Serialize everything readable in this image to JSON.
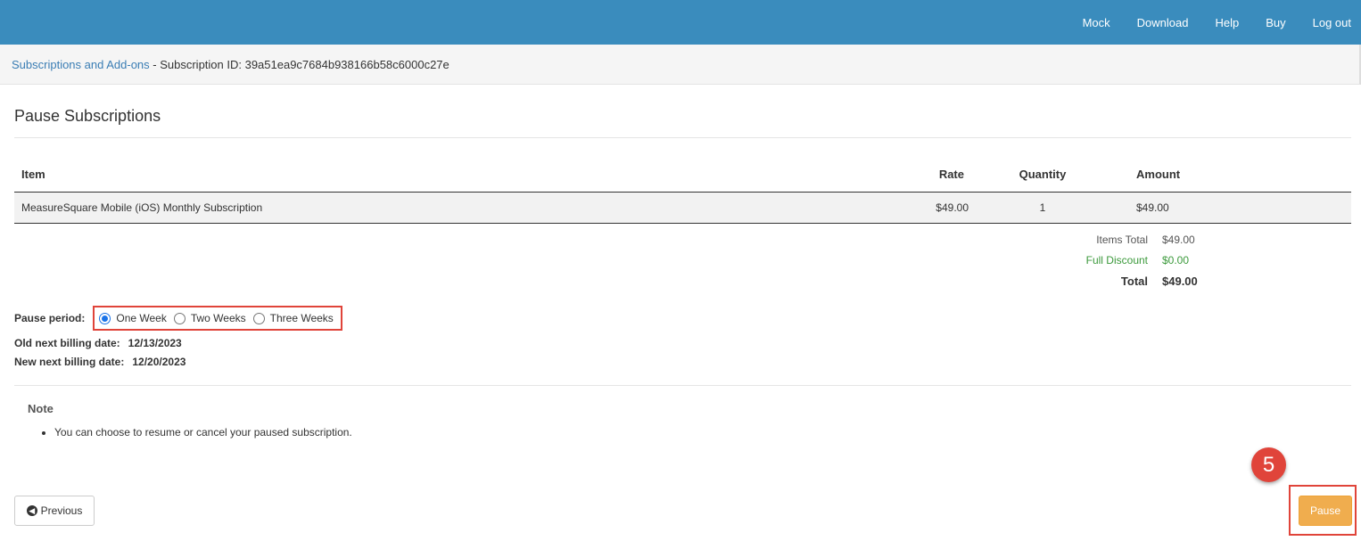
{
  "nav": {
    "items": [
      "Mock",
      "Download",
      "Help",
      "Buy",
      "Log out"
    ]
  },
  "breadcrumb": {
    "link": "Subscriptions and Add-ons",
    "separator": " - ",
    "text": "Subscription ID: 39a51ea9c7684b938166b58c6000c27e"
  },
  "page": {
    "title": "Pause Subscriptions"
  },
  "table": {
    "headers": {
      "item": "Item",
      "rate": "Rate",
      "quantity": "Quantity",
      "amount": "Amount"
    },
    "rows": [
      {
        "item": "MeasureSquare Mobile (iOS) Monthly Subscription",
        "rate": "$49.00",
        "quantity": "1",
        "amount": "$49.00"
      }
    ]
  },
  "totals": {
    "items_total_label": "Items Total",
    "items_total_value": "$49.00",
    "discount_label": "Full Discount",
    "discount_value": "$0.00",
    "total_label": "Total",
    "total_value": "$49.00"
  },
  "pause": {
    "label": "Pause period:",
    "options": [
      "One Week",
      "Two Weeks",
      "Three Weeks"
    ],
    "selected": "One Week"
  },
  "billing": {
    "old_label": "Old next billing date:",
    "old_value": "12/13/2023",
    "new_label": "New next billing date:",
    "new_value": "12/20/2023"
  },
  "note": {
    "title": "Note",
    "items": [
      "You can choose to resume or cancel your paused subscription."
    ]
  },
  "buttons": {
    "previous": "Previous",
    "pause": "Pause"
  },
  "annotation": {
    "step": "5"
  },
  "colors": {
    "topbar": "#3a8cbd",
    "link": "#3a7db4",
    "highlight": "#e0443a",
    "pause_button": "#f0ad4e",
    "discount": "#3c9a3c"
  }
}
